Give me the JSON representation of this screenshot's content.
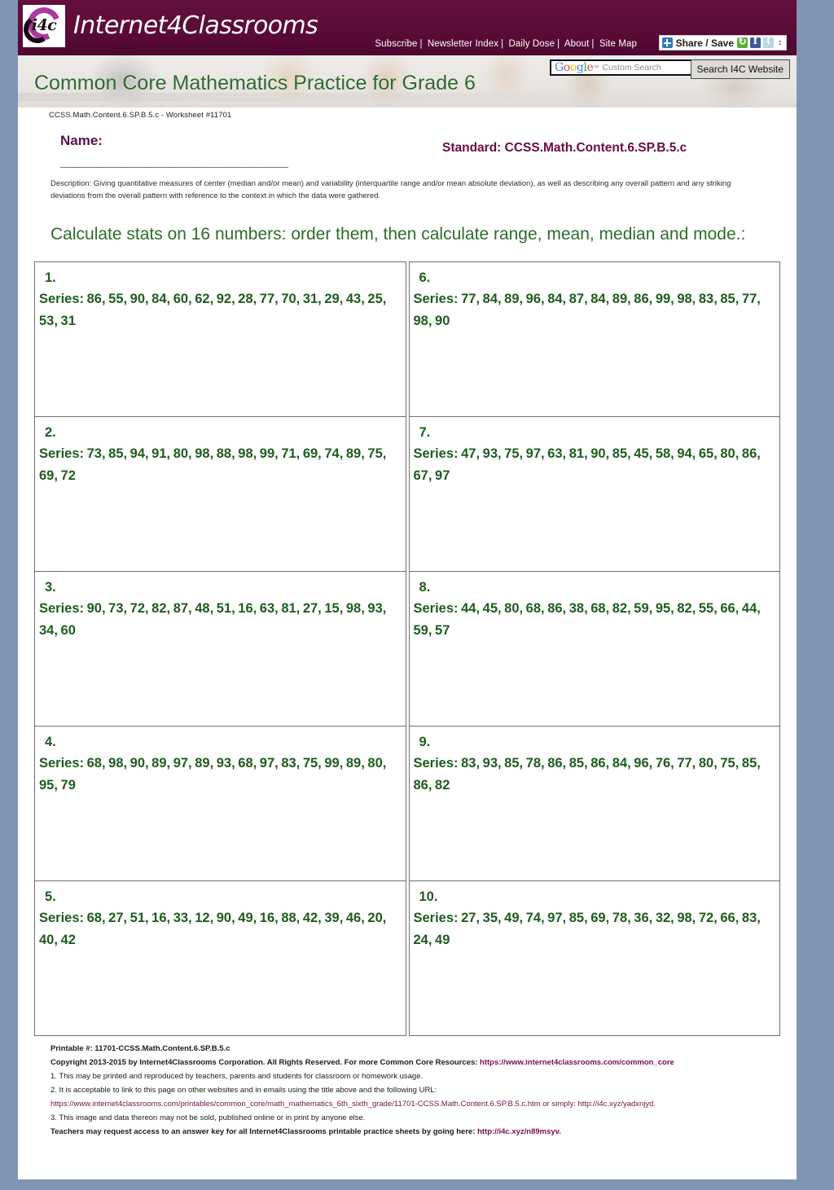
{
  "site": {
    "logo_badge_text": "i4c",
    "logo_text": "Internet4Classrooms",
    "nav": [
      {
        "label": "Subscribe"
      },
      {
        "label": "Newsletter Index"
      },
      {
        "label": "Daily Dose"
      },
      {
        "label": "About"
      },
      {
        "label": "Site Map"
      }
    ],
    "nav_separator": "|",
    "share": {
      "label": "Share / Save",
      "icons": [
        "plus-icon",
        "share-refresh-icon",
        "facebook-icon",
        "twitter-icon",
        "updown-arrows-icon"
      ],
      "updown_glyph": "↕"
    },
    "search": {
      "brand": "Google",
      "brand_tm": "™",
      "placeholder": "Custom Search",
      "value": "",
      "button_label": "Search I4C Website"
    },
    "banner_title": "Common Core Mathematics Practice for Grade 6"
  },
  "worksheet": {
    "worksheet_id": "CCSS.Math.Content.6.SP.B.5.c - Worksheet #11701",
    "name_label": "Name:",
    "name_line": "______________________________________",
    "standard": "Standard: CCSS.Math.Content.6.SP.B.5.c",
    "description": "Description: Giving quantitative measures of center (median and/or mean) and variability (interquartile range and/or mean absolute deviation), as well as describing any overall pattern and any striking deviations from the overall pattern with reference to the context in which the data were gathered.",
    "instructions": "Calculate stats on 16 numbers: order them, then calculate range, mean, median and mode.:",
    "series_prefix": "Series: ",
    "problems": [
      {
        "number": "1.",
        "series": "Series: 86, 55, 90, 84, 60, 62, 92, 28, 77, 70, 31, 29, 43, 25, 53, 31"
      },
      {
        "number": "2.",
        "series": "Series: 73, 85, 94, 91, 80, 98, 88, 98, 99, 71, 69, 74, 89, 75, 69, 72"
      },
      {
        "number": "3.",
        "series": "Series: 90, 73, 72, 82, 87, 48, 51, 16, 63, 81, 27, 15, 98, 93, 34, 60"
      },
      {
        "number": "4.",
        "series": "Series: 68, 98, 90, 89, 97, 89, 93, 68, 97, 83, 75, 99, 89, 80, 95, 79"
      },
      {
        "number": "5.",
        "series": "Series: 68, 27, 51, 16, 33, 12, 90, 49, 16, 88, 42, 39, 46, 20, 40, 42"
      },
      {
        "number": "6.",
        "series": "Series: 77, 84, 89, 96, 84, 87, 84, 89, 86, 99, 98, 83, 85, 77, 98, 90"
      },
      {
        "number": "7.",
        "series": "Series: 47, 93, 75, 97, 63, 81, 90, 85, 45, 58, 94, 65, 80, 86, 67, 97"
      },
      {
        "number": "8.",
        "series": "Series: 44, 45, 80, 68, 86, 38, 68, 82, 59, 95, 82, 55, 66, 44, 59, 57"
      },
      {
        "number": "9.",
        "series": "Series: 83, 93, 85, 78, 86, 85, 86, 84, 96, 76, 77, 80, 75, 85, 86, 82"
      },
      {
        "number": "10.",
        "series": "Series: 27, 35, 49, 74, 97, 85, 69, 78, 36, 32, 98, 72, 66, 83, 24, 49"
      }
    ]
  },
  "footer": {
    "printable": "Printable #: 11701-CCSS.Math.Content.6.SP.B.5.c",
    "copyright_prefix": "Copyright 2013-2015 by Internet4Classrooms Corporation. All Rights Reserved. For more Common Core Resources: ",
    "copyright_link": "https://www.internet4classrooms.com/common_core",
    "note1": "1. This may be printed and reproduced by teachers, parents and students for classroom or homework usage.",
    "note2": "2. It is acceptable to link to this page on other websites and in emails using the title above and the following URL:",
    "url_line": "https://www.internet4classrooms.com/printables/common_core/math_mathematics_6th_sixth_grade/11701-CCSS.Math.Content.6.SP.B.5.c.htm or simply: http://i4c.xyz/yadxnjyd.",
    "note3": "3. This image and data thereon may not be sold, published online or in print by anyone else.",
    "answer_key_prefix": "Teachers may request access to an answer key for all Internet4Classrooms printable practice sheets by going here: ",
    "answer_key_link": "http://i4c.xyz/n89msyv."
  },
  "colors": {
    "brand_maroon": "#5d0b38",
    "heading_green": "#2f6b2b",
    "series_green": "#1f5c1f",
    "standard_purple": "#6b0a42",
    "page_backdrop": "#8094b4",
    "link_purple": "#7a0c4e"
  }
}
